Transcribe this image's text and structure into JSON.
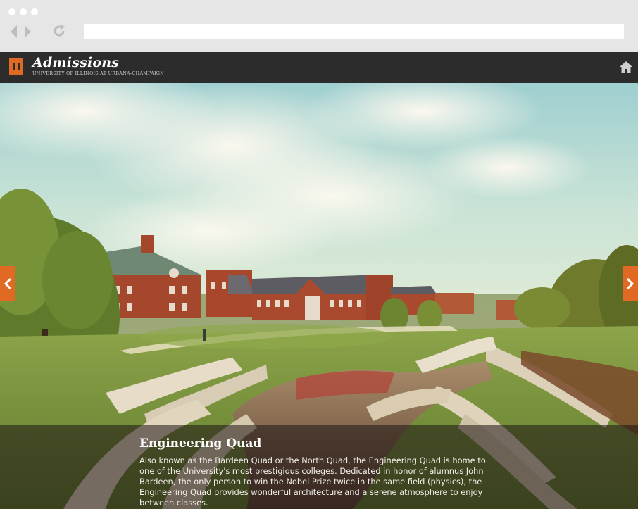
{
  "browser": {
    "back_icon": "back-arrow-icon",
    "forward_icon": "forward-arrow-icon",
    "reload_icon": "reload-icon",
    "address": ""
  },
  "header": {
    "logo_icon": "illinois-block-i-logo",
    "title": "Admissions",
    "subtitle": "UNIVERSITY OF ILLINOIS AT URBANA-CHAMPAIGN",
    "home_icon": "home-icon"
  },
  "slide": {
    "title": "Engineering Quad",
    "body": "Also known as the Bardeen Quad or the North Quad, the Engineering Quad is home to one of the University's most prestigious colleges. Dedicated in honor of alumnus John Bardeen, the only person to win the Nobel Prize twice in the same field (physics), the Engineering Quad provides wonderful architecture and a serene atmosphere to enjoy between classes.",
    "prev_icon": "chevron-left-icon",
    "next_icon": "chevron-right-icon"
  },
  "colors": {
    "brand_orange": "#e06a23",
    "header_bg": "#2c2c2c"
  }
}
